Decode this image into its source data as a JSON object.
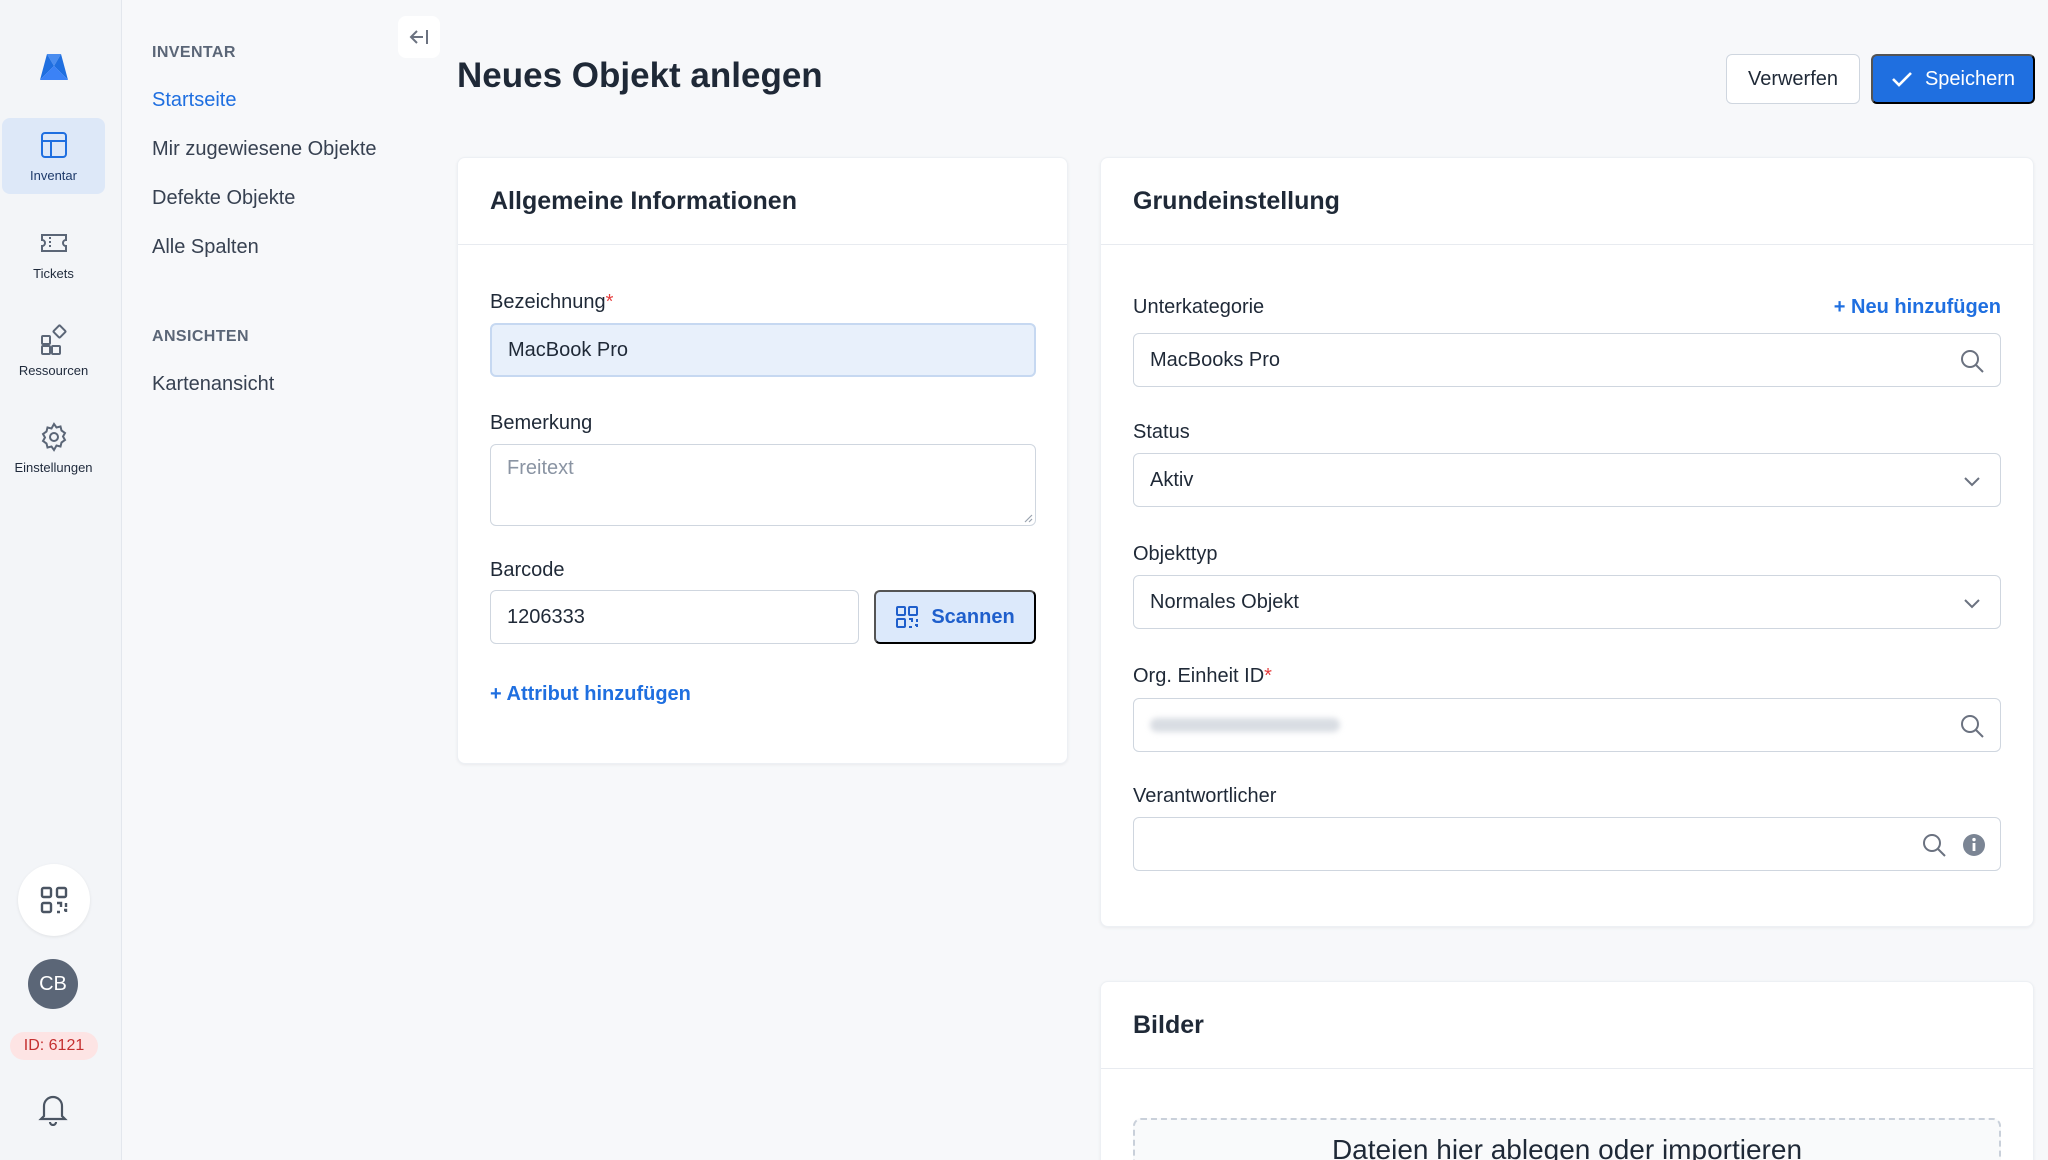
{
  "rail": {
    "items": [
      {
        "label": "Inventar",
        "icon": "table-icon"
      },
      {
        "label": "Tickets",
        "icon": "ticket-icon"
      },
      {
        "label": "Ressourcen",
        "icon": "resources-icon"
      },
      {
        "label": "Einstellungen",
        "icon": "gear-icon"
      }
    ],
    "avatar_initials": "CB",
    "id_badge": "ID: 6121"
  },
  "subnav": {
    "section1": "INVENTAR",
    "links1": [
      "Startseite",
      "Mir zugewiesene Objekte",
      "Defekte Objekte",
      "Alle Spalten"
    ],
    "section2": "ANSICHTEN",
    "links2": [
      "Kartenansicht"
    ]
  },
  "header": {
    "title": "Neues Objekt anlegen",
    "discard_label": "Verwerfen",
    "save_label": "Speichern"
  },
  "general": {
    "title": "Allgemeine Informationen",
    "name_label": "Bezeichnung",
    "name_value": "MacBook Pro",
    "remark_label": "Bemerkung",
    "remark_placeholder": "Freitext",
    "barcode_label": "Barcode",
    "barcode_value": "1206333",
    "scan_label": "Scannen",
    "add_attribute": "+ Attribut hinzufügen"
  },
  "basic": {
    "title": "Grundeinstellung",
    "subcategory_label": "Unterkategorie",
    "add_new": "+ Neu hinzufügen",
    "subcategory_value": "MacBooks Pro",
    "status_label": "Status",
    "status_value": "Aktiv",
    "type_label": "Objekttyp",
    "type_value": "Normales Objekt",
    "org_label": "Org. Einheit ID",
    "responsible_label": "Verantwortlicher"
  },
  "images": {
    "title": "Bilder",
    "dropzone_text": "Dateien hier ablegen oder importieren"
  },
  "colors": {
    "accent": "#1f6fe0",
    "required": "#e53e3e",
    "id_badge_bg": "#fde4e4"
  }
}
